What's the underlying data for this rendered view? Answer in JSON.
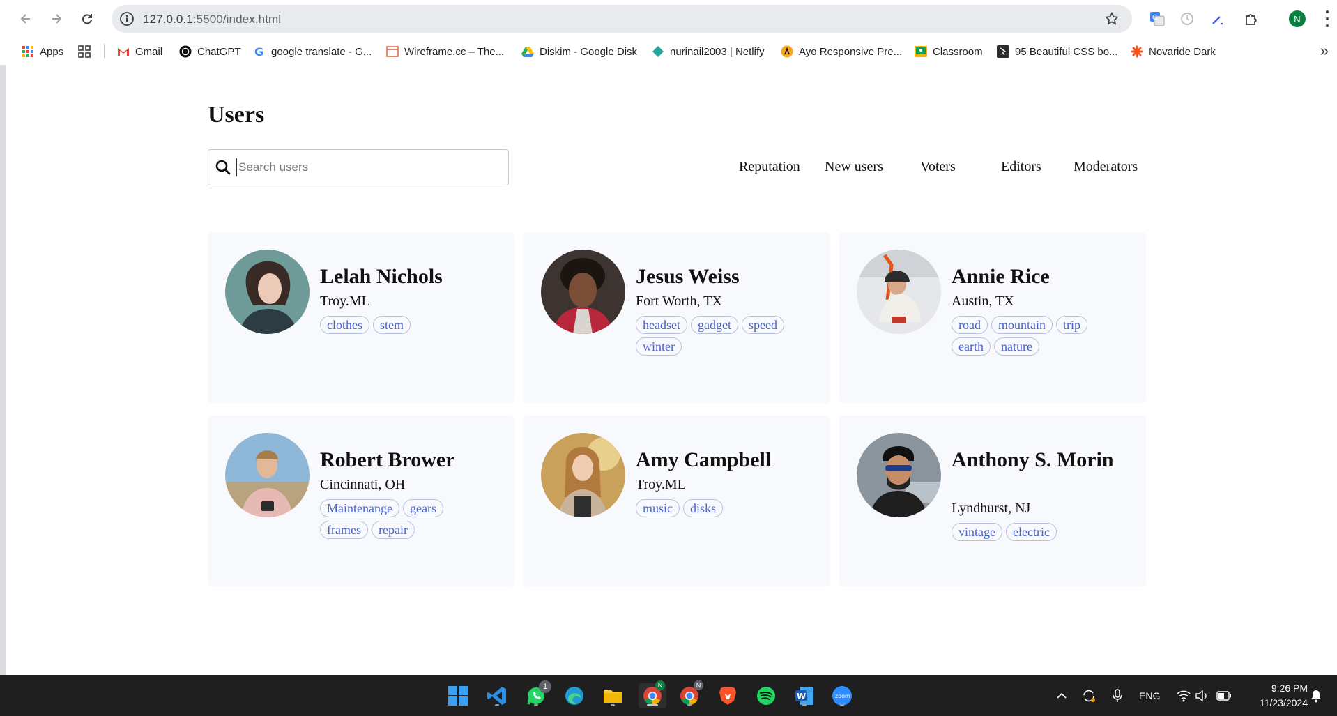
{
  "browser": {
    "url_host": "127.0.0.1",
    "url_rest": ":5500/index.html",
    "profile_initial": "N",
    "bookmarks": [
      {
        "label": "Apps",
        "icon": "apps-grid-icon"
      },
      {
        "label": "",
        "icon": "tab-groups-icon"
      },
      {
        "label": "Gmail",
        "icon": "gmail-icon"
      },
      {
        "label": "ChatGPT",
        "icon": "chatgpt-icon"
      },
      {
        "label": "google translate - G...",
        "icon": "google-icon"
      },
      {
        "label": "Wireframe.cc – The...",
        "icon": "wireframe-icon"
      },
      {
        "label": "Diskim - Google Disk",
        "icon": "google-drive-icon"
      },
      {
        "label": "nurinail2003 | Netlify",
        "icon": "netlify-icon"
      },
      {
        "label": "Ayo Responsive Pre...",
        "icon": "ayo-icon"
      },
      {
        "label": "Classroom",
        "icon": "classroom-icon"
      },
      {
        "label": "95 Beautiful CSS bo...",
        "icon": "css-icon"
      },
      {
        "label": "Novaride Dark",
        "icon": "novaride-icon"
      }
    ]
  },
  "page": {
    "title": "Users",
    "search": {
      "placeholder": "Search users",
      "value": ""
    },
    "filters": [
      "Reputation",
      "New users",
      "Voters",
      "Editors",
      "Moderators"
    ]
  },
  "users": [
    {
      "name": "Lelah Nichols",
      "location": "Troy.ML",
      "tags": [
        "clothes",
        "stem"
      ],
      "avatar_color": "#6e8f8c"
    },
    {
      "name": "Jesus Weiss",
      "location": "Fort Worth, TX",
      "tags": [
        "headset",
        "gadget",
        "speed",
        "winter"
      ],
      "avatar_color": "#4b3a33"
    },
    {
      "name": "Annie Rice",
      "location": "Austin, TX",
      "tags": [
        "road",
        "mountain",
        "trip",
        "earth",
        "nature"
      ],
      "avatar_color": "#dcdde0"
    },
    {
      "name": "Robert Brower",
      "location": "Cincinnati, OH",
      "tags": [
        "Maintenange",
        "gears",
        "frames",
        "repair"
      ],
      "avatar_color": "#7fa8c9"
    },
    {
      "name": "Amy Campbell",
      "location": "Troy.ML",
      "tags": [
        "music",
        "disks"
      ],
      "avatar_color": "#c9a15a"
    },
    {
      "name": "Anthony S. Morin",
      "location": "Lyndhurst, NJ",
      "tags": [
        "vintage",
        "electric"
      ],
      "avatar_color": "#5a6570"
    }
  ],
  "taskbar": {
    "apps": [
      "windows-start-icon",
      "vscode-icon",
      "whatsapp-icon",
      "edge-icon",
      "file-explorer-icon",
      "chrome-icon",
      "chrome-icon",
      "brave-icon",
      "spotify-icon",
      "word-icon",
      "zoom-icon"
    ],
    "whatsapp_badge": "1",
    "language": "ENG",
    "time": "9:26 PM",
    "date": "11/23/2024"
  }
}
